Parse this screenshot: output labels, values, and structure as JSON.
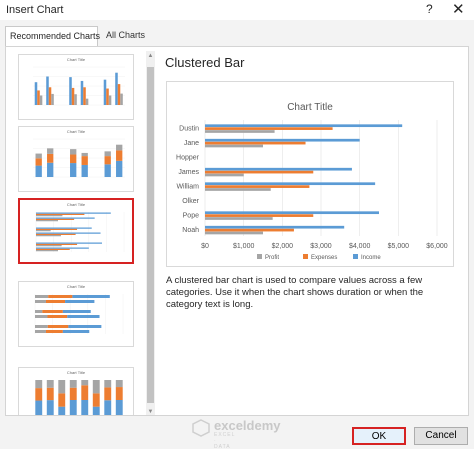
{
  "window": {
    "title": "Insert Chart",
    "help_glyph": "?",
    "close_glyph": "✕"
  },
  "tabs": [
    {
      "label": "Recommended Charts"
    },
    {
      "label": "All Charts"
    }
  ],
  "thumbnails": [
    {
      "title": "Chart Title",
      "kind": "clustered-column",
      "legend": "Income  Expenses  Profit"
    },
    {
      "title": "Chart Title",
      "kind": "stacked-column",
      "legend": ""
    },
    {
      "title": "Chart Title",
      "kind": "clustered-bar",
      "legend": "Profit  Expenses  Income"
    },
    {
      "title": "Chart Title",
      "kind": "stacked-bar",
      "legend": ""
    },
    {
      "title": "Chart Title",
      "kind": "stacked-column-100",
      "legend": ""
    }
  ],
  "chart_type_name": "Clustered Bar",
  "description": "A clustered bar chart is used to compare values across a few categories. Use it when the chart shows duration or when the category text is long.",
  "colors": {
    "profit": "#a5a5a5",
    "expenses": "#ed7d31",
    "income": "#5b9bd5",
    "highlight": "#d62222"
  },
  "chart_data": {
    "type": "bar",
    "orientation": "horizontal",
    "title": "Chart Title",
    "categories": [
      "Noah",
      "Pope",
      "Olker",
      "William",
      "James",
      "Hopper",
      "Jane",
      "Dustin"
    ],
    "series": [
      {
        "name": "Profit",
        "values": [
          1500,
          1750,
          0,
          1700,
          1000,
          0,
          1500,
          1800
        ]
      },
      {
        "name": "Expenses",
        "values": [
          2300,
          2800,
          0,
          2700,
          2800,
          0,
          2600,
          3300
        ]
      },
      {
        "name": "Income",
        "values": [
          3600,
          4500,
          0,
          4400,
          3800,
          0,
          4000,
          5100
        ]
      }
    ],
    "xlim": [
      0,
      6000
    ],
    "ticks": [
      "$0",
      "$1,000",
      "$2,000",
      "$3,000",
      "$4,000",
      "$5,000",
      "$6,000"
    ],
    "legend_position": "bottom",
    "grid": true
  },
  "watermark": {
    "name": "exceldemy",
    "sub": "EXCEL · DATA · BI"
  },
  "buttons": {
    "ok": "OK",
    "cancel": "Cancel"
  }
}
